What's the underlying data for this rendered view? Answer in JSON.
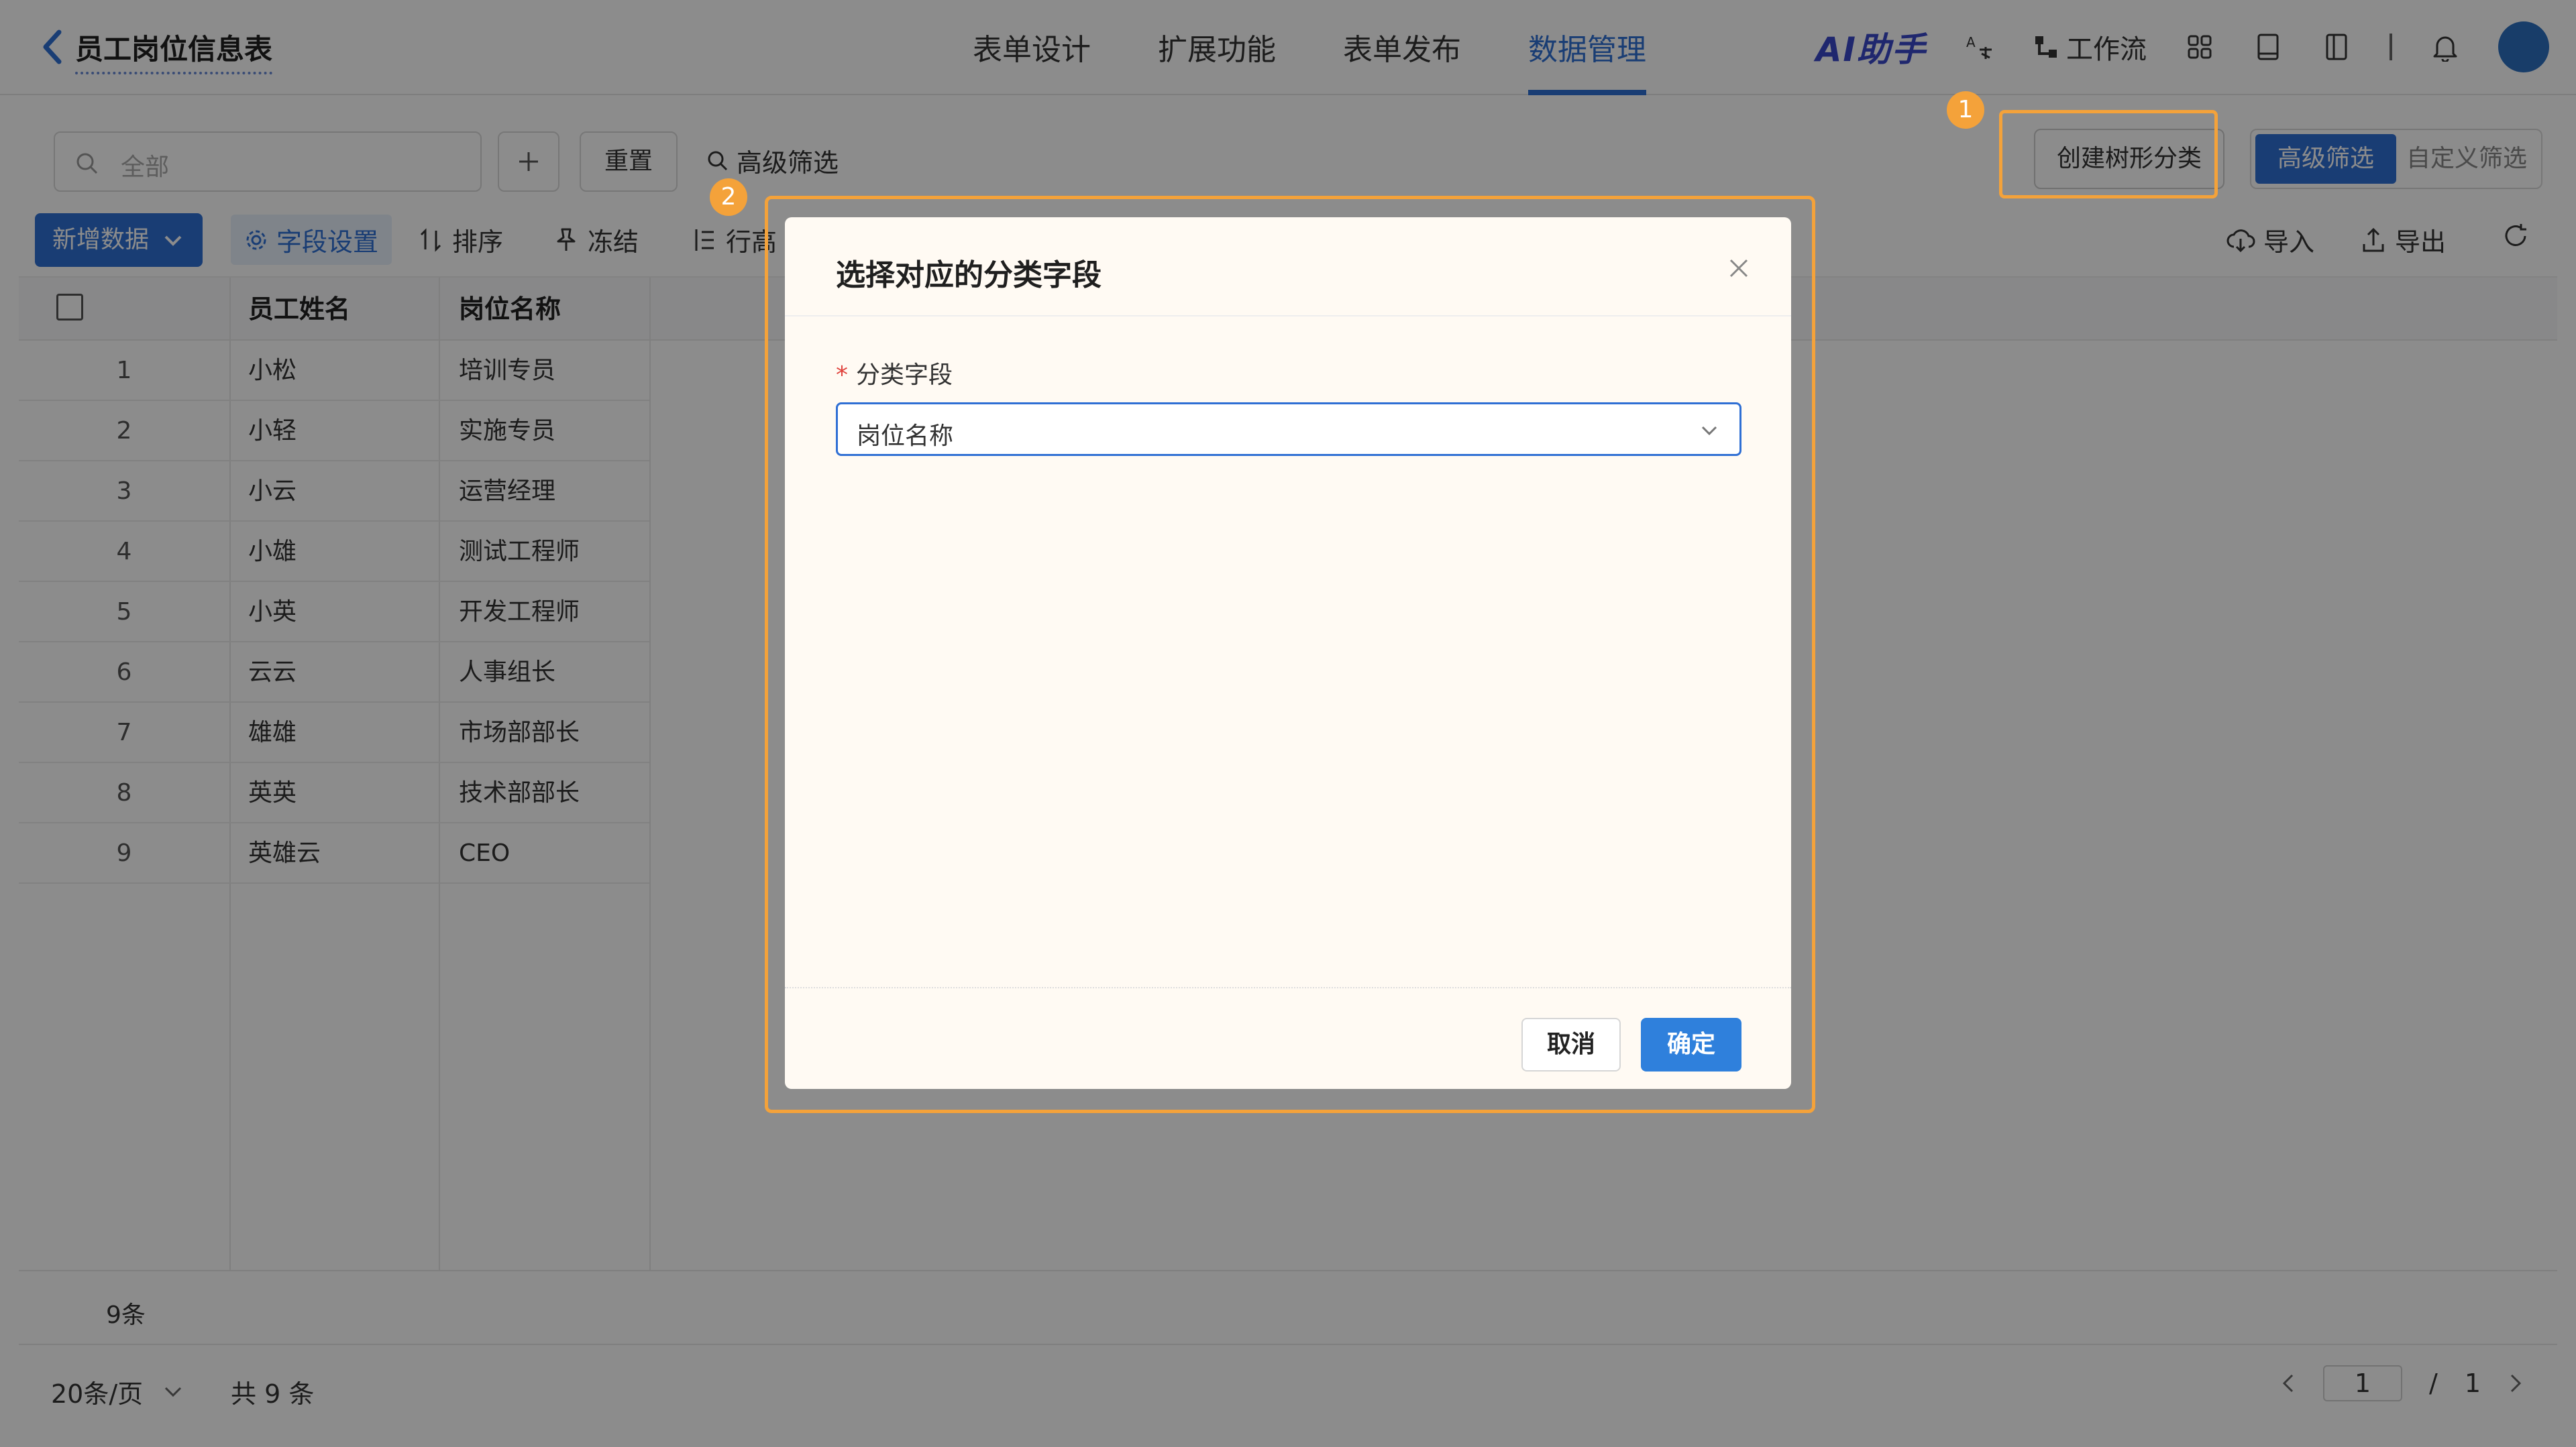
{
  "header": {
    "app_title": "员工岗位信息表",
    "nav_tabs": [
      "表单设计",
      "扩展功能",
      "表单发布",
      "数据管理"
    ],
    "active_tab": "数据管理",
    "ai_label": "AI助手",
    "workflow_label": "工作流",
    "accent_color": "#2f6fd4"
  },
  "filter": {
    "search_placeholder": "全部",
    "reset_label": "重置",
    "advanced_link": "高级筛选",
    "create_tree_label": "创建树形分类",
    "segment": [
      "高级筛选",
      "自定义筛选"
    ]
  },
  "toolbar": {
    "new_data": "新增数据",
    "field_settings": "字段设置",
    "sort": "排序",
    "freeze": "冻结",
    "row_height": "行高",
    "import": "导入",
    "export": "导出"
  },
  "table": {
    "headers": [
      "员工姓名",
      "岗位名称"
    ],
    "rows": [
      {
        "no": "1",
        "name": "小松",
        "position": "培训专员"
      },
      {
        "no": "2",
        "name": "小轻",
        "position": "实施专员"
      },
      {
        "no": "3",
        "name": "小云",
        "position": "运营经理"
      },
      {
        "no": "4",
        "name": "小雄",
        "position": "测试工程师"
      },
      {
        "no": "5",
        "name": "小英",
        "position": "开发工程师"
      },
      {
        "no": "6",
        "name": "云云",
        "position": "人事组长"
      },
      {
        "no": "7",
        "name": "雄雄",
        "position": "市场部部长"
      },
      {
        "no": "8",
        "name": "英英",
        "position": "技术部部长"
      },
      {
        "no": "9",
        "name": "英雄云",
        "position": "CEO"
      }
    ],
    "footer_count": "9条"
  },
  "pagination": {
    "per_page": "20条/页",
    "total": "共 9 条",
    "current": "1",
    "divider": "/",
    "total_pages": "1"
  },
  "annotations": {
    "badge1": "1",
    "badge2": "2",
    "highlight_color": "#f4a23a"
  },
  "modal": {
    "title": "选择对应的分类字段",
    "field_label": "分类字段",
    "required_mark": "*",
    "selected_value": "岗位名称",
    "cancel": "取消",
    "ok": "确定"
  }
}
